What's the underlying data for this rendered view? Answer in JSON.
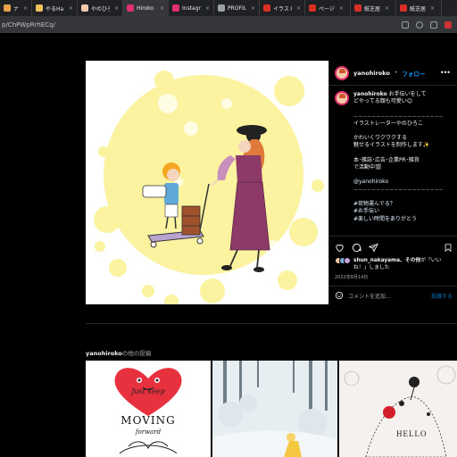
{
  "browser": {
    "tabs": [
      {
        "label": "ナルマール",
        "color": "#e8a24a",
        "active": false
      },
      {
        "label": "やるHa!!",
        "color": "#f0c05a",
        "active": false
      },
      {
        "label": "やのひろこ",
        "color": "#f3c9a8",
        "active": false
      },
      {
        "label": "Hiroko Ya",
        "color": "#e1306c",
        "active": true
      },
      {
        "label": "Instagram",
        "color": "#e1306c",
        "active": false
      },
      {
        "label": "PROFILE",
        "color": "#9aa0a6",
        "active": false
      },
      {
        "label": "イラスト",
        "color": "#d93025",
        "active": false
      },
      {
        "label": "ページ",
        "color": "#d93025",
        "active": false
      },
      {
        "label": "紙芝居",
        "color": "#d93025",
        "active": false
      },
      {
        "label": "紙芝居",
        "color": "#d93025",
        "active": false
      }
    ],
    "tab_close": "×",
    "url": "p/ChPWpRrhECq/"
  },
  "post": {
    "username": "yanohiroko",
    "follow_label": "フォロー",
    "dot": "•",
    "more_label": "•••",
    "caption_lines": [
      "お手伝いをして",
      "どやってる顔も可愛い😊",
      "",
      "−−−−−−−−−−−−−−−−−−−−",
      "イラストレーターやのひろこ",
      "",
      "かわいくワクワクする",
      "魅せるイラストを制作します✨",
      "",
      "本･雑誌･広告･企業PR･雑貨",
      "で活動中🎬",
      "",
      "@yanohiroko",
      "−−−−−−−−−−−−−−−−−−−−",
      "",
      "#荷物運んでる？",
      "#お手伝い",
      "#楽しい時間をありがとう"
    ],
    "likes": {
      "user": "shun_nakayama",
      "rest_1": "、その他",
      "rest_2": "が「いいね！」しました"
    },
    "date": "2022年8月14日",
    "comment_placeholder": "コメントを追加...",
    "post_button": "投稿する",
    "avatar_colors": [
      "#f3c9a8",
      "#7db0d8",
      "#c9a3d9"
    ]
  },
  "more_posts": {
    "username": "yanohiroko",
    "title_suffix": "の他の投稿",
    "items": [
      {
        "name": "moving-forward-post",
        "line1": "Just keep",
        "line2": "MOVING",
        "line3": "forward"
      },
      {
        "name": "winter-forest-post"
      },
      {
        "name": "hello-dress-post",
        "text": "HELLO"
      }
    ]
  },
  "colors": {
    "background": "#000000",
    "accent_blue": "#0095f6",
    "moon_yellow": "#fbf3a0",
    "dress_purple": "#8e3a69"
  }
}
